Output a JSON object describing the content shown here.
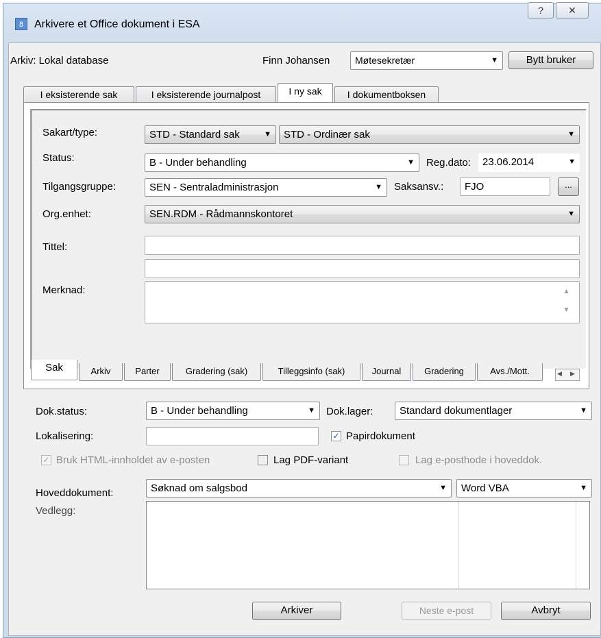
{
  "window": {
    "title": "Arkivere et Office dokument i ESA",
    "app_icon": "esa-app-icon",
    "help_glyph": "?",
    "close_glyph": "✕"
  },
  "header": {
    "archive_label": "Arkiv: Lokal database",
    "user_name": "Finn Johansen",
    "role_value": "Møtesekretær",
    "switch_user_label": "Bytt bruker"
  },
  "top_tabs": [
    {
      "label": "I eksisterende sak"
    },
    {
      "label": "I eksisterende journalpost"
    },
    {
      "label": "I ny sak"
    },
    {
      "label": "I dokumentboksen"
    }
  ],
  "case": {
    "type_label": "Sakart/type:",
    "type_value_1": "STD - Standard sak",
    "type_value_2": "STD - Ordinær sak",
    "status_label": "Status:",
    "status_value": "B - Under behandling",
    "regdate_label": "Reg.dato:",
    "regdate_value": "23.06.2014",
    "access_label": "Tilgangsgruppe:",
    "access_value": "SEN - Sentraladministrasjon",
    "officer_label": "Saksansv.:",
    "officer_value": "FJO",
    "officer_browse": "...",
    "org_label": "Org.enhet:",
    "org_value": "SEN.RDM - Rådmannskontoret",
    "title_label": "Tittel:",
    "title_value_1": "",
    "title_value_2": "",
    "note_label": "Merknad:",
    "note_value": ""
  },
  "bottom_tabs": [
    {
      "label": "Sak"
    },
    {
      "label": "Arkiv"
    },
    {
      "label": "Parter"
    },
    {
      "label": "Gradering (sak)"
    },
    {
      "label": "Tilleggsinfo (sak)"
    },
    {
      "label": "Journal"
    },
    {
      "label": "Gradering"
    },
    {
      "label": "Avs./Mott."
    }
  ],
  "document": {
    "status_label": "Dok.status:",
    "status_value": "B - Under behandling",
    "storage_label": "Dok.lager:",
    "storage_value": "Standard dokumentlager",
    "location_label": "Lokalisering:",
    "location_value": "",
    "paper_label": "Papirdokument",
    "paper_checked": true,
    "html_label": "Bruk HTML-innholdet av e-posten",
    "html_checked": true,
    "pdf_label": "Lag PDF-variant",
    "pdf_checked": false,
    "header_label": "Lag e-posthode i hoveddok.",
    "header_checked": false,
    "main_doc_label": "Hoveddokument:",
    "main_doc_value": "Søknad om salgsbod",
    "template_value": "Word VBA",
    "attachments_label": "Vedlegg:"
  },
  "footer": {
    "archive_button": "Arkiver",
    "next_email_button": "Neste e-post",
    "cancel_button": "Avbryt"
  },
  "icons": {
    "dropdown": "▼",
    "check": "✓",
    "scroll_up": "▲",
    "scroll_down": "▼",
    "tab_left": "◀",
    "tab_right": "▶"
  }
}
